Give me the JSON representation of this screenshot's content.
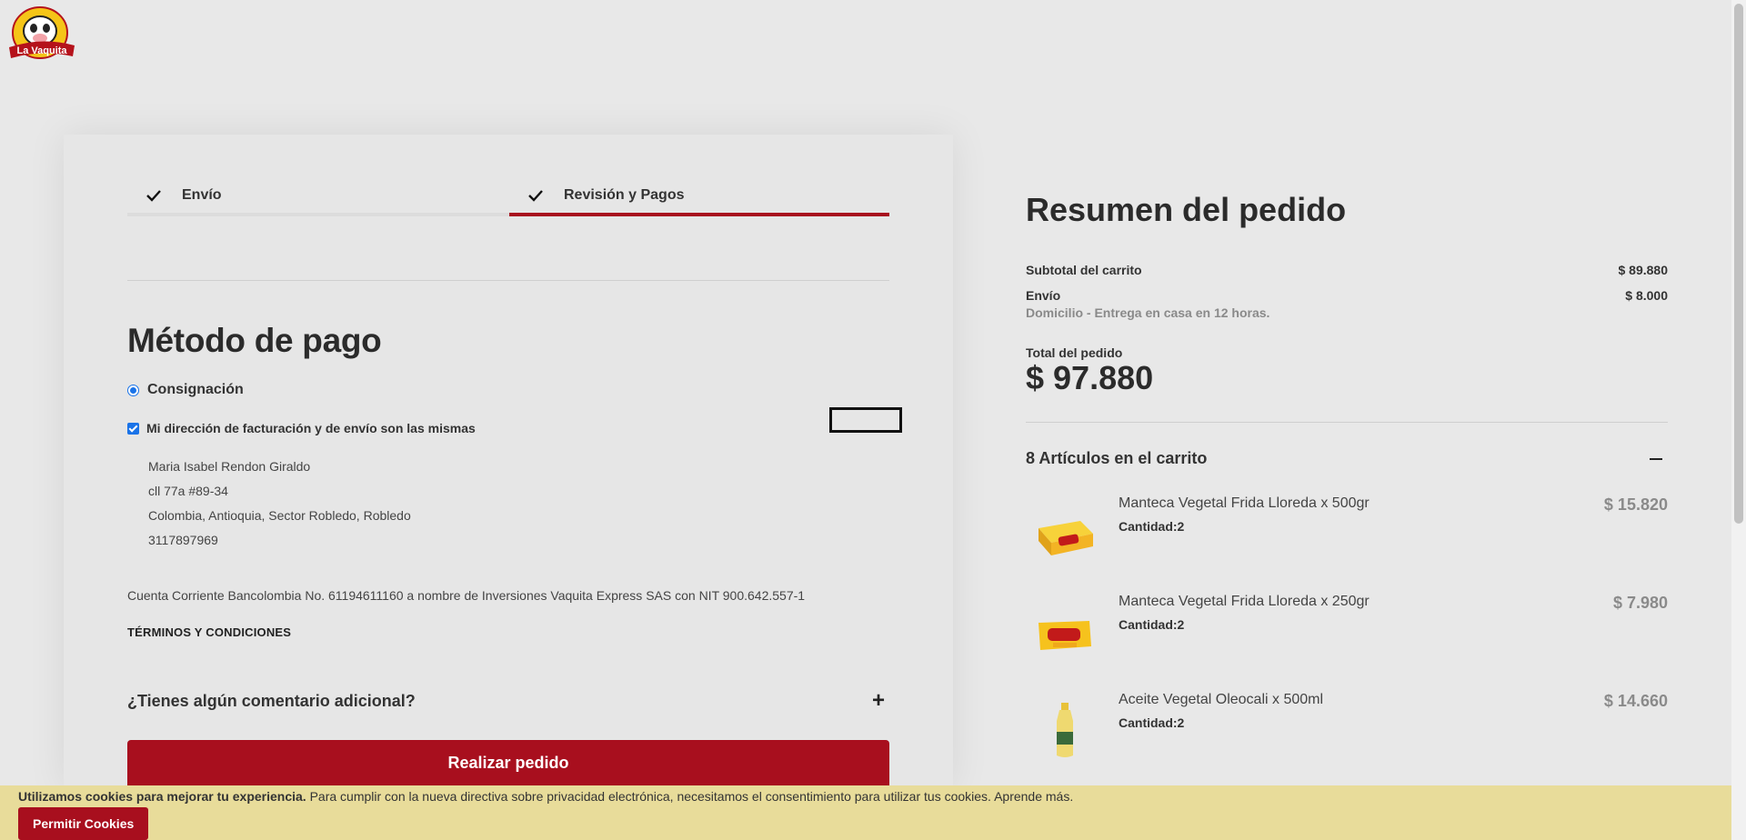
{
  "brand": {
    "name": "La Vaquita",
    "accent": "#a80f1e"
  },
  "steps": [
    {
      "label": "Envío",
      "status": "done"
    },
    {
      "label": "Revisión y Pagos",
      "status": "active"
    }
  ],
  "payment": {
    "title": "Método de pago",
    "method_label": "Consignación",
    "same_address_label": "Mi dirección de facturación y de envío son las mismas",
    "address": {
      "name": "Maria Isabel Rendon Giraldo",
      "street": "cll 77a #89-34",
      "location": "Colombia, Antioquia, Sector Robledo, Robledo",
      "phone": "3117897969"
    },
    "bank_info": "Cuenta Corriente Bancolombia No. 61194611160 a nombre de Inversiones Vaquita Express SAS con NIT 900.642.557-1",
    "terms_label": "TÉRMINOS Y CONDICIONES",
    "comment_label": "¿Tienes algún comentario adicional?",
    "place_order_label": "Realizar pedido"
  },
  "summary": {
    "title": "Resumen del pedido",
    "subtotal_label": "Subtotal del carrito",
    "subtotal_value": "$ 89.880",
    "shipping_label": "Envío",
    "shipping_value": "$ 8.000",
    "shipping_desc": "Domicilio - Entrega en casa en 12 horas.",
    "total_label": "Total del pedido",
    "total_value": "$ 97.880",
    "items_heading": "8 Artículos en el carrito",
    "items": [
      {
        "name": "Manteca Vegetal Frida Lloreda x 500gr",
        "qty": "Cantidad:2",
        "price": "$ 15.820"
      },
      {
        "name": "Manteca Vegetal Frida Lloreda x 250gr",
        "qty": "Cantidad:2",
        "price": "$ 7.980"
      },
      {
        "name": "Aceite Vegetal Oleocali x 500ml",
        "qty": "Cantidad:2",
        "price": "$ 14.660"
      }
    ]
  },
  "cookie": {
    "bold": "Utilizamos cookies para mejorar tu experiencia.",
    "text": " Para cumplir con la nueva directiva sobre privacidad electrónica, necesitamos el consentimiento para utilizar tus cookies. Aprende más.",
    "button_label": "Permitir Cookies"
  }
}
